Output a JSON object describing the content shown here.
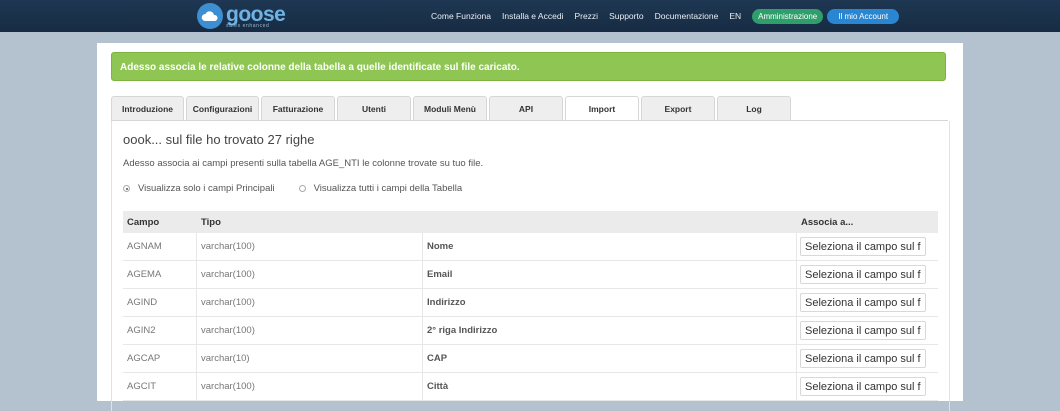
{
  "brand": {
    "name": "goose",
    "tagline": "sales enhanced"
  },
  "nav": {
    "links": [
      "Come Funziona",
      "Installa e Accedi",
      "Prezzi",
      "Supporto",
      "Documentazione",
      "EN"
    ],
    "admin_label": "Amministrazione",
    "account_label": "Il mio Account"
  },
  "alert": "Adesso associa le relative colonne della tabella a quelle identificate sul file caricato.",
  "tabs": [
    "Introduzione",
    "Configurazioni",
    "Fatturazione",
    "Utenti",
    "Moduli Menù",
    "API",
    "Import",
    "Export",
    "Log"
  ],
  "active_tab": "Import",
  "heading": "oook... sul file ho trovato 27 righe",
  "description": "Adesso associa ai campi presenti sulla tabella AGE_NTI le colonne trovate su tuo file.",
  "radios": [
    {
      "label": "Visualizza solo i campi Principali",
      "checked": true
    },
    {
      "label": "Visualizza tutti i campi della Tabella",
      "checked": false
    }
  ],
  "table": {
    "headers": {
      "campo": "Campo",
      "tipo": "Tipo",
      "associa": "Associa a..."
    },
    "rows": [
      {
        "campo": "AGNAM",
        "tipo": "varchar(100)",
        "label": "Nome",
        "select": "Seleziona il campo sul f"
      },
      {
        "campo": "AGEMA",
        "tipo": "varchar(100)",
        "label": "Email",
        "select": "Seleziona il campo sul f"
      },
      {
        "campo": "AGIND",
        "tipo": "varchar(100)",
        "label": "Indirizzo",
        "select": "Seleziona il campo sul f"
      },
      {
        "campo": "AGIN2",
        "tipo": "varchar(100)",
        "label": "2° riga Indirizzo",
        "select": "Seleziona il campo sul f"
      },
      {
        "campo": "AGCAP",
        "tipo": "varchar(10)",
        "label": "CAP",
        "select": "Seleziona il campo sul f"
      },
      {
        "campo": "AGCIT",
        "tipo": "varchar(100)",
        "label": "Città",
        "select": "Seleziona il campo sul f"
      }
    ]
  },
  "colors": {
    "topbar": "#1b324b",
    "alert": "#8fc653",
    "admin_btn": "#2f9e6a",
    "account_btn": "#2a86d0"
  }
}
